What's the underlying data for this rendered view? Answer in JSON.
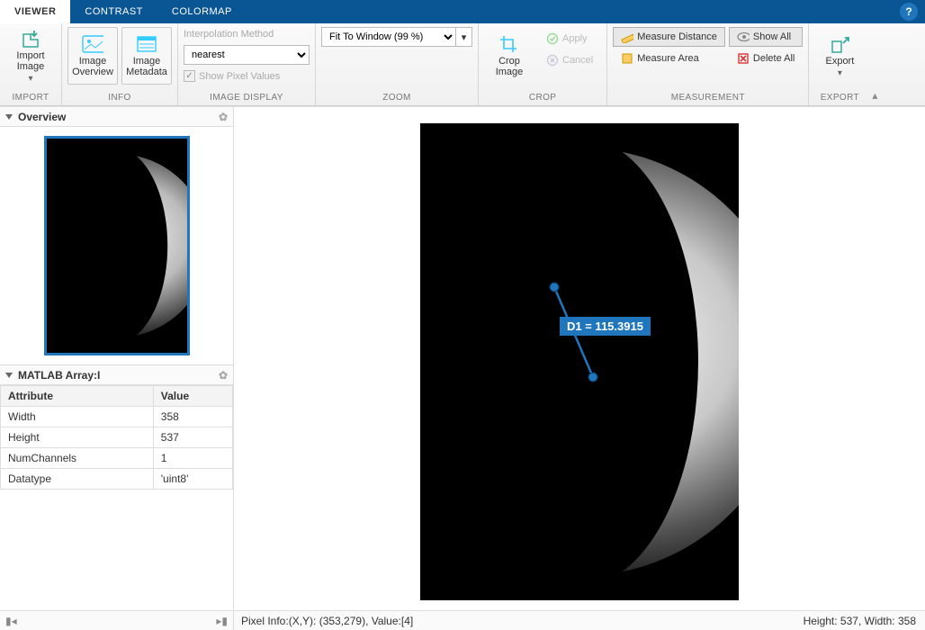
{
  "tabs": {
    "viewer": "VIEWER",
    "contrast": "CONTRAST",
    "colormap": "COLORMAP"
  },
  "import": {
    "label": "Import\nImage",
    "drop": "▾",
    "group": "IMPORT"
  },
  "info": {
    "overview": "Image\nOverview",
    "metadata": "Image\nMetadata",
    "group": "INFO"
  },
  "display": {
    "interp_label": "Interpolation Method",
    "interp_value": "nearest",
    "show_px": "Show Pixel Values",
    "group": "IMAGE DISPLAY"
  },
  "zoom": {
    "fit": "Fit To Window (99 %)",
    "group": "ZOOM"
  },
  "crop": {
    "crop": "Crop\nImage",
    "apply": "Apply",
    "cancel": "Cancel",
    "group": "CROP"
  },
  "meas": {
    "dist": "Measure Distance",
    "area": "Measure Area",
    "showall": "Show All",
    "deleteall": "Delete All",
    "group": "MEASUREMENT"
  },
  "export": {
    "label": "Export",
    "drop": "▾",
    "group": "EXPORT"
  },
  "panes": {
    "overview": "Overview",
    "array": "MATLAB Array:I"
  },
  "attrs": {
    "head_attr": "Attribute",
    "head_val": "Value",
    "rows": [
      {
        "a": "Width",
        "v": "358"
      },
      {
        "a": "Height",
        "v": "537"
      },
      {
        "a": "NumChannels",
        "v": "1"
      },
      {
        "a": "Datatype",
        "v": "'uint8'"
      }
    ]
  },
  "distance": {
    "label": "D1 = 115.3915"
  },
  "status": {
    "pixel": "Pixel Info:(X,Y): (353,279), Value:[4]",
    "dims": "Height: 537, Width: 358"
  },
  "colors": {
    "accent": "#1f76bd"
  }
}
